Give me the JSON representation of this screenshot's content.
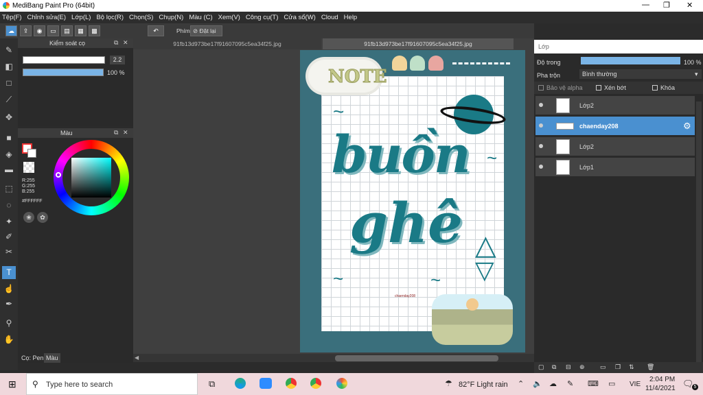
{
  "window": {
    "title": "MediBang Paint Pro (64bit)",
    "minimize": "—",
    "restore": "❐",
    "close": "✕"
  },
  "menu": [
    "Tệp(F)",
    "Chỉnh sửa(E)",
    "Lớp(L)",
    "Bộ lọc(R)",
    "Chọn(S)",
    "Chụp(N)",
    "Màu (C)",
    "Xem(V)",
    "Công cụ(T)",
    "Cửa sổ(W)",
    "Cloud",
    "Help"
  ],
  "toolbar": {
    "phim_label": "Phím",
    "reset_label": "Đặt lại"
  },
  "brush_panel": {
    "title": "Kiểm soát cọ",
    "size_value": "2.2",
    "opacity_value": "100 %"
  },
  "color_panel": {
    "title": "Màu",
    "r": "R:255",
    "g": "G:255",
    "b": "B:255",
    "hex": "#FFFFFF"
  },
  "bottom_tabs": {
    "tab1": "Cọ: Pen",
    "tab2": "Màu"
  },
  "tabs": {
    "tab1": "91fb13d973be17f91607095c5ea34f25.jpg",
    "tab2": "91fb13d973be17f91607095c5ea34f25.jpg"
  },
  "artwork": {
    "note": "NOTE",
    "line1": "buồn",
    "line2": "ghê",
    "signature": "chaenday208"
  },
  "layers_panel": {
    "title": "Lớp",
    "opacity_label": "Độ trong",
    "opacity_value": "100 %",
    "blend_label": "Pha trộn",
    "blend_value": "Bình thường",
    "protect_alpha": "Bảo vệ alpha",
    "clip": "Xén bớt",
    "lock": "Khóa",
    "layers": [
      {
        "name": "Lớp2"
      },
      {
        "name": "chaenday208"
      },
      {
        "name": "Lớp2"
      },
      {
        "name": "Lớp1"
      }
    ]
  },
  "taskbar": {
    "search_placeholder": "Type here to search",
    "weather": "82°F  Light rain",
    "lang": "VIE",
    "time": "2:04 PM",
    "date": "11/4/2021",
    "notif": "5"
  },
  "colors": {
    "accent": "#4a90d0",
    "teal": "#1a7a86",
    "bg_teal": "#3a6f7c"
  }
}
